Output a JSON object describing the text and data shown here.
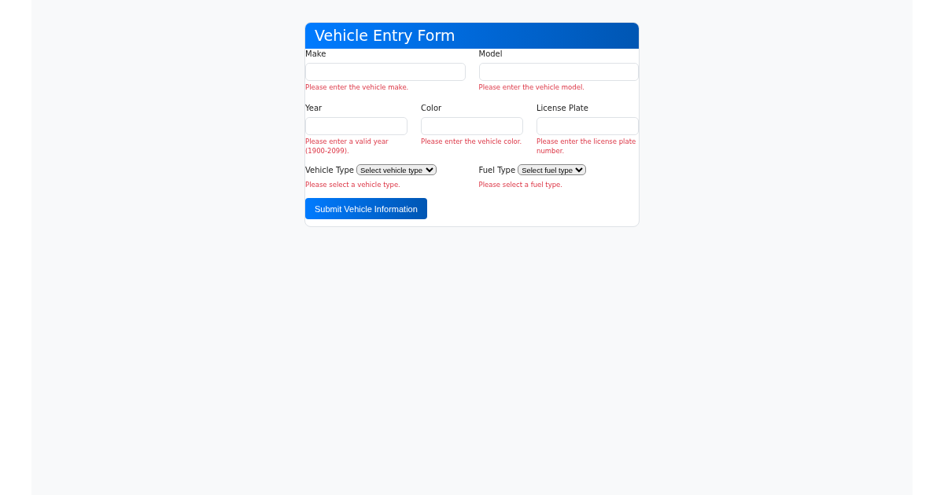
{
  "form": {
    "title": "Vehicle Entry Form",
    "text_rows": [
      [
        {
          "label": "Make",
          "error": "Please enter the vehicle make."
        },
        {
          "label": "Model",
          "error": "Please enter the vehicle model."
        }
      ],
      [
        {
          "label": "Year",
          "error": "Please enter a valid year (1900-2099)."
        },
        {
          "label": "Color",
          "error": "Please enter the vehicle color."
        },
        {
          "label": "License Plate",
          "error": "Please enter the license plate number."
        }
      ]
    ],
    "selects": [
      {
        "label": "Vehicle Type",
        "value": "Select vehicle type",
        "error": "Please select a vehicle type."
      },
      {
        "label": "Fuel Type",
        "value": "Select fuel type",
        "error": "Please select a fuel type."
      }
    ],
    "submit": "Submit Vehicle Information"
  }
}
